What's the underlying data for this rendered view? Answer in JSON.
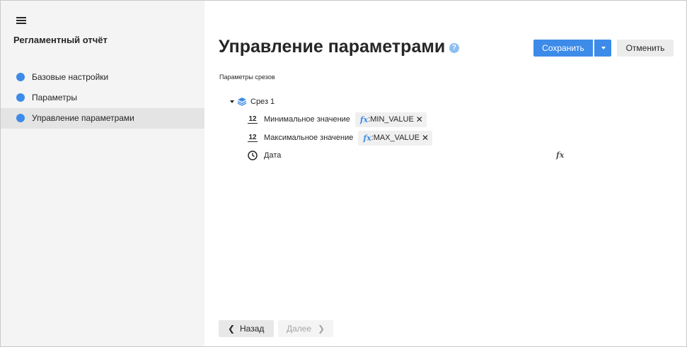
{
  "sidebar": {
    "menu_icon": "hamburger-menu-icon",
    "title": "Регламентный отчёт",
    "items": [
      {
        "label": "Базовые настройки",
        "active": false
      },
      {
        "label": "Параметры",
        "active": false
      },
      {
        "label": "Управление параметрами",
        "active": true
      }
    ]
  },
  "header": {
    "title": "Управление параметрами",
    "help_icon": "question-circle-icon",
    "help_glyph": "?",
    "save_label": "Сохранить",
    "save_dropdown_icon": "chevron-down-icon",
    "cancel_label": "Отменить"
  },
  "slices": {
    "section_label": "Параметры срезов",
    "root": {
      "label": "Срез 1",
      "icon": "layers-icon",
      "params": [
        {
          "type_icon": "number-type-icon",
          "type_glyph": "12",
          "label": "Минимальное значение",
          "formula_prefix": "fx",
          "formula": ":MIN_VALUE",
          "remove_glyph": "✕"
        },
        {
          "type_icon": "number-type-icon",
          "type_glyph": "12",
          "label": "Максимальное значение",
          "formula_prefix": "fx",
          "formula": ":MAX_VALUE",
          "remove_glyph": "✕"
        },
        {
          "type_icon": "clock-icon",
          "label": "Дата",
          "formula_button": "fx"
        }
      ]
    }
  },
  "footer": {
    "back_label": "Назад",
    "back_glyph": "❮",
    "next_label": "Далее",
    "next_glyph": "❯",
    "next_enabled": false
  },
  "colors": {
    "accent": "#3d8be8",
    "sidebar_bg": "#f4f4f4",
    "active_item_bg": "#e4e4e4"
  }
}
